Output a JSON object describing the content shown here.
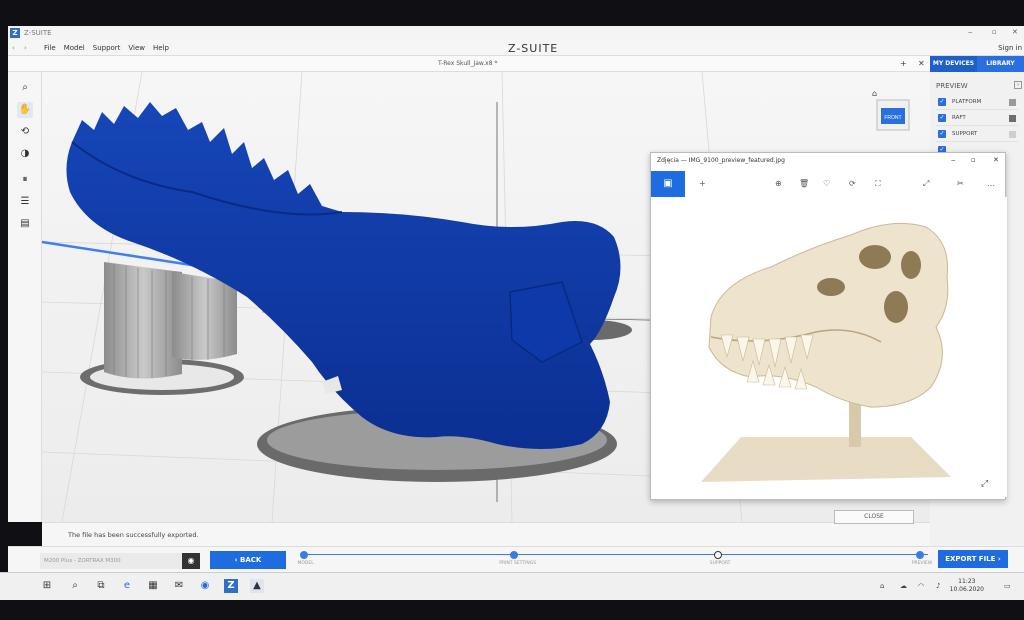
{
  "window": {
    "app_title": "Z-SUITE",
    "logo_letter": "Z",
    "min": "‒",
    "max": "▫",
    "close": "✕"
  },
  "menu": {
    "back": "‹",
    "forward": "›",
    "items": [
      "File",
      "Model",
      "Support",
      "View",
      "Help"
    ],
    "brand": "Z-SUITE",
    "sign_in": "Sign in"
  },
  "tabbar": {
    "filename": "T-Rex Skull_Jaw.x8 *",
    "add": "+",
    "close": "✕"
  },
  "right_panel": {
    "tabs": [
      "MY DEVICES",
      "LIBRARY"
    ],
    "preview_heading": "PREVIEW",
    "items": [
      {
        "label": "PLATFORM",
        "swatch": "#9a9a9a"
      },
      {
        "label": "RAFT",
        "swatch": "#6d6d6d"
      },
      {
        "label": "SUPPORT",
        "swatch": "#cfcfcf"
      }
    ],
    "accent": "#1f5fc8"
  },
  "viewcube": {
    "label": "FRONT",
    "home": "⌂"
  },
  "left_tools": [
    {
      "name": "zoom-icon",
      "glyph": "⌕"
    },
    {
      "name": "hand-icon",
      "glyph": "✋"
    },
    {
      "name": "rotate-icon",
      "glyph": "⟲"
    },
    {
      "name": "view-icon",
      "glyph": "◑"
    },
    {
      "name": "pause-icon",
      "glyph": "⏸"
    },
    {
      "name": "layers-icon",
      "glyph": "☰"
    },
    {
      "name": "grid-icon",
      "glyph": "▤"
    }
  ],
  "status": {
    "message": "The file has been successfully exported."
  },
  "bottom": {
    "device_placeholder": "M200 Plus - ZORTRAX M300",
    "back_label": "‹  BACK",
    "export_label": "EXPORT FILE  ›",
    "steps": [
      "MODEL",
      "PRINT SETTINGS",
      "SUPPORT",
      "PREVIEW"
    ],
    "close_label": "CLOSE"
  },
  "photos": {
    "title": "Zdjęcia — IMG_9100_preview_featured.jpg",
    "toolbar": [
      "+",
      "⊕",
      "🗑",
      "♡",
      "⟳",
      "⛶",
      "⤢",
      "✂",
      "…"
    ]
  },
  "taskbar": {
    "time": "11:23",
    "date": "10.06.2020",
    "icons": [
      "⊞",
      "⌕",
      "⧉",
      "e",
      "▦",
      "✉",
      "◉",
      "Z",
      "▲"
    ]
  }
}
